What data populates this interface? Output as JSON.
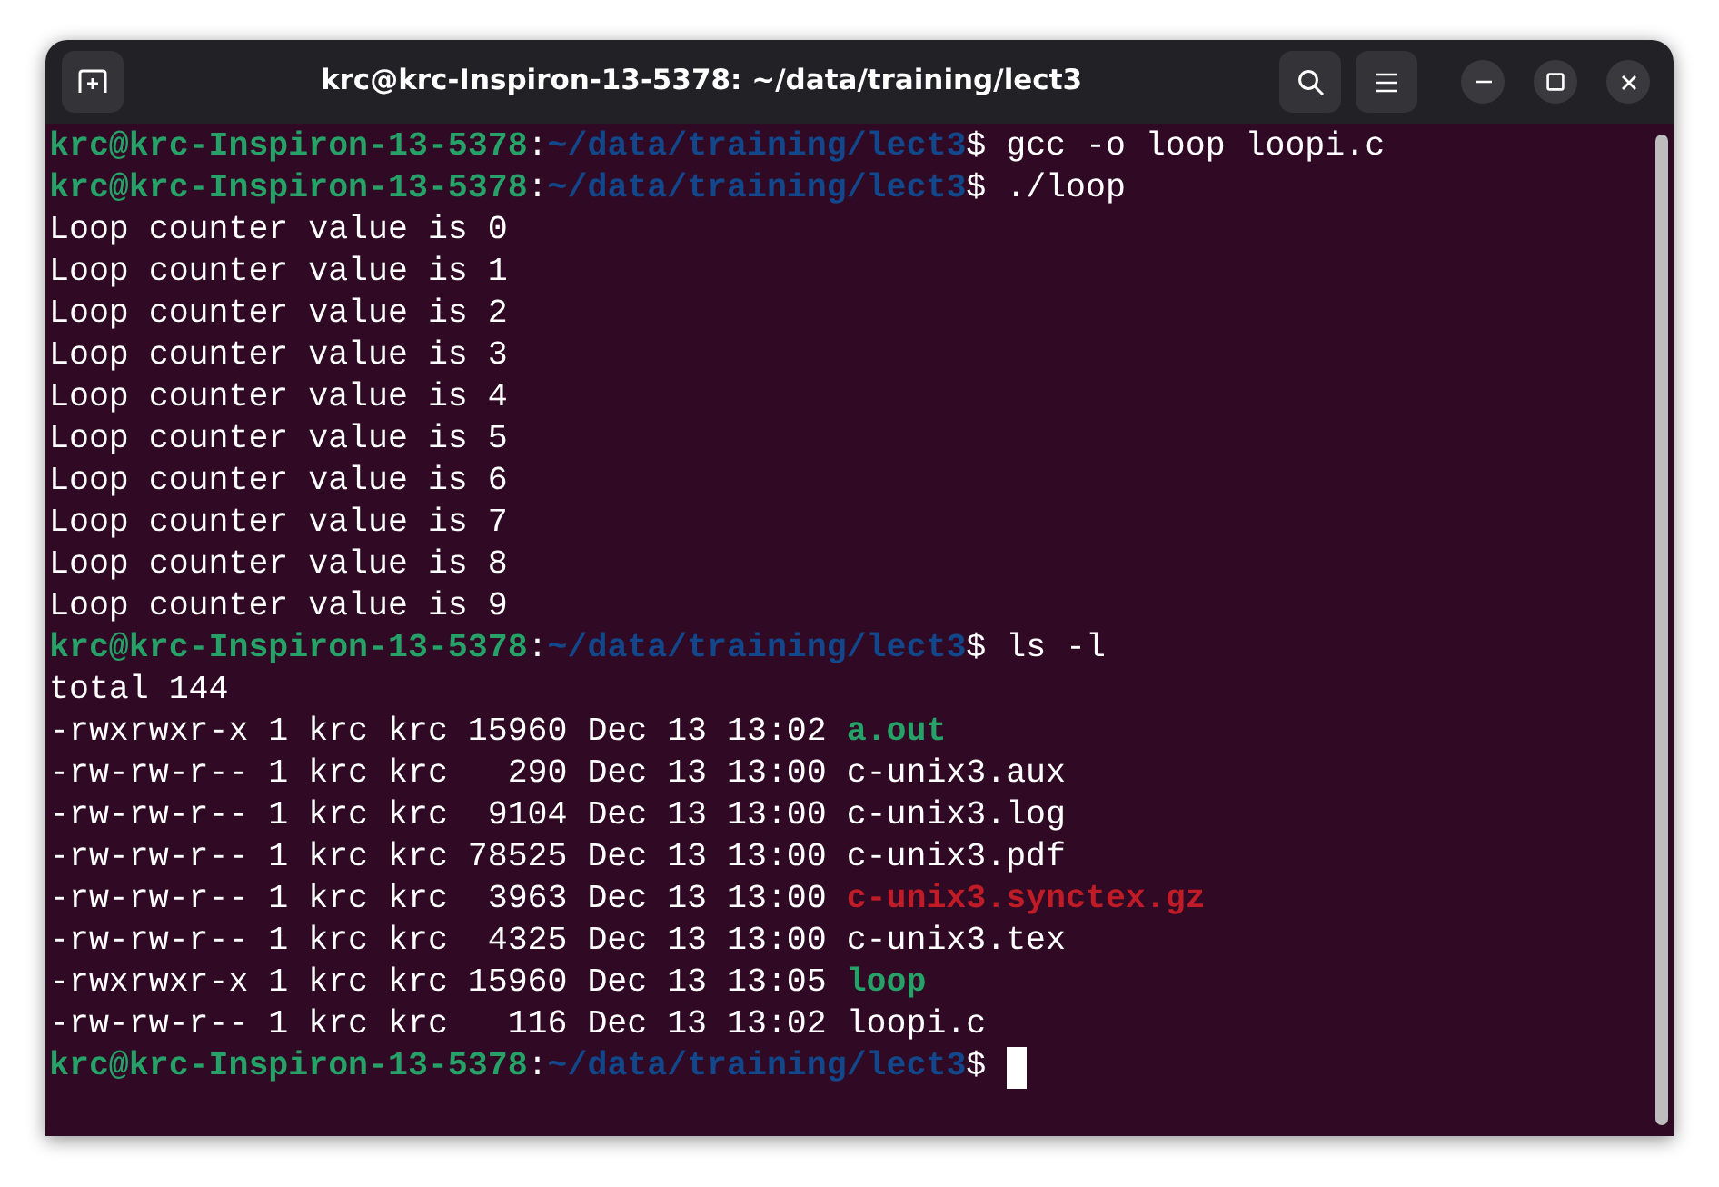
{
  "window": {
    "title": "krc@krc-Inspiron-13-5378: ~/data/training/lect3"
  },
  "terminal": {
    "lines": [
      {
        "segments": [
          {
            "kind": "user",
            "text": "krc@krc-Inspiron-13-5378"
          },
          {
            "kind": "plain",
            "text": ":"
          },
          {
            "kind": "path",
            "text": "~/data/training/lect3"
          },
          {
            "kind": "plain",
            "text": "$ gcc -o loop loopi.c"
          }
        ]
      },
      {
        "segments": [
          {
            "kind": "user",
            "text": "krc@krc-Inspiron-13-5378"
          },
          {
            "kind": "plain",
            "text": ":"
          },
          {
            "kind": "path",
            "text": "~/data/training/lect3"
          },
          {
            "kind": "plain",
            "text": "$ ./loop"
          }
        ]
      },
      {
        "segments": [
          {
            "kind": "plain",
            "text": "Loop counter value is 0"
          }
        ]
      },
      {
        "segments": [
          {
            "kind": "plain",
            "text": "Loop counter value is 1"
          }
        ]
      },
      {
        "segments": [
          {
            "kind": "plain",
            "text": "Loop counter value is 2"
          }
        ]
      },
      {
        "segments": [
          {
            "kind": "plain",
            "text": "Loop counter value is 3"
          }
        ]
      },
      {
        "segments": [
          {
            "kind": "plain",
            "text": "Loop counter value is 4"
          }
        ]
      },
      {
        "segments": [
          {
            "kind": "plain",
            "text": "Loop counter value is 5"
          }
        ]
      },
      {
        "segments": [
          {
            "kind": "plain",
            "text": "Loop counter value is 6"
          }
        ]
      },
      {
        "segments": [
          {
            "kind": "plain",
            "text": "Loop counter value is 7"
          }
        ]
      },
      {
        "segments": [
          {
            "kind": "plain",
            "text": "Loop counter value is 8"
          }
        ]
      },
      {
        "segments": [
          {
            "kind": "plain",
            "text": "Loop counter value is 9"
          }
        ]
      },
      {
        "segments": [
          {
            "kind": "user",
            "text": "krc@krc-Inspiron-13-5378"
          },
          {
            "kind": "plain",
            "text": ":"
          },
          {
            "kind": "path",
            "text": "~/data/training/lect3"
          },
          {
            "kind": "plain",
            "text": "$ ls -l"
          }
        ]
      },
      {
        "segments": [
          {
            "kind": "plain",
            "text": "total 144"
          }
        ]
      },
      {
        "segments": [
          {
            "kind": "plain",
            "text": "-rwxrwxr-x 1 krc krc 15960 Dec 13 13:02 "
          },
          {
            "kind": "executable",
            "text": "a.out"
          }
        ]
      },
      {
        "segments": [
          {
            "kind": "plain",
            "text": "-rw-rw-r-- 1 krc krc   290 Dec 13 13:00 c-unix3.aux"
          }
        ]
      },
      {
        "segments": [
          {
            "kind": "plain",
            "text": "-rw-rw-r-- 1 krc krc  9104 Dec 13 13:00 c-unix3.log"
          }
        ]
      },
      {
        "segments": [
          {
            "kind": "plain",
            "text": "-rw-rw-r-- 1 krc krc 78525 Dec 13 13:00 c-unix3.pdf"
          }
        ]
      },
      {
        "segments": [
          {
            "kind": "plain",
            "text": "-rw-rw-r-- 1 krc krc  3963 Dec 13 13:00 "
          },
          {
            "kind": "archive",
            "text": "c-unix3.synctex.gz"
          }
        ]
      },
      {
        "segments": [
          {
            "kind": "plain",
            "text": "-rw-rw-r-- 1 krc krc  4325 Dec 13 13:00 c-unix3.tex"
          }
        ]
      },
      {
        "segments": [
          {
            "kind": "plain",
            "text": "-rwxrwxr-x 1 krc krc 15960 Dec 13 13:05 "
          },
          {
            "kind": "executable",
            "text": "loop"
          }
        ]
      },
      {
        "segments": [
          {
            "kind": "plain",
            "text": "-rw-rw-r-- 1 krc krc   116 Dec 13 13:02 loopi.c"
          }
        ]
      },
      {
        "segments": [
          {
            "kind": "user",
            "text": "krc@krc-Inspiron-13-5378"
          },
          {
            "kind": "plain",
            "text": ":"
          },
          {
            "kind": "path",
            "text": "~/data/training/lect3"
          },
          {
            "kind": "plain",
            "text": "$ "
          }
        ],
        "cursor": true
      }
    ]
  }
}
